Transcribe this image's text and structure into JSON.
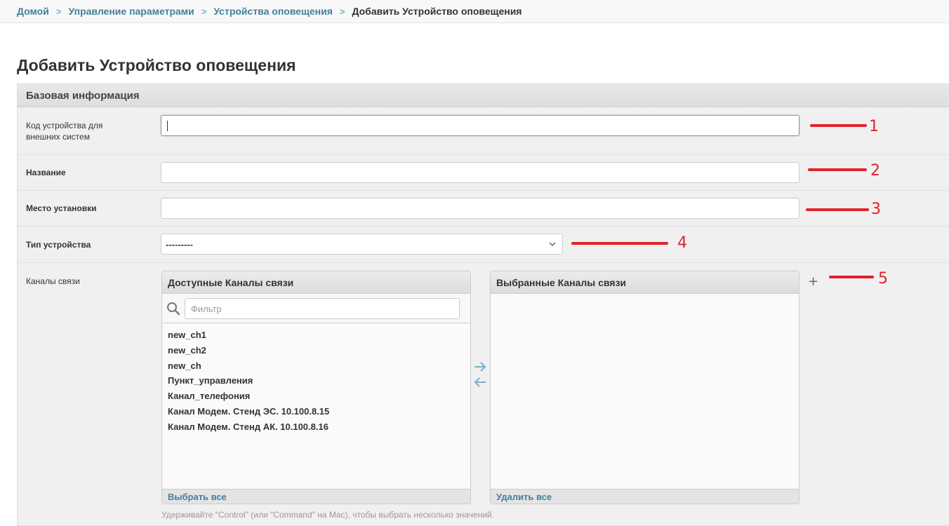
{
  "breadcrumbs": {
    "home": "Домой",
    "settings": "Управление параметрами",
    "devices": "Устройства оповещения",
    "current": "Добавить Устройство оповещения",
    "separator": ">"
  },
  "page": {
    "title": "Добавить Устройство оповещения"
  },
  "fieldset": {
    "title": "Базовая информация"
  },
  "fields": {
    "external_code": {
      "label": "Код устройства для внешних систем",
      "value": ""
    },
    "name": {
      "label": "Название",
      "value": ""
    },
    "location": {
      "label": "Место установки",
      "value": ""
    },
    "device_type": {
      "label": "Тип устройства",
      "selected": "---------"
    },
    "channels": {
      "label": "Каналы связи"
    }
  },
  "channels": {
    "available_title": "Доступные Каналы связи",
    "filter_placeholder": "Фильтр",
    "available": [
      "new_ch1",
      "new_ch2",
      "new_ch",
      "Пункт_управления",
      "Канал_телефония",
      "Канал Модем. Стенд ЭС. 10.100.8.15",
      "Канал Модем. Стенд АК. 10.100.8.16"
    ],
    "choose_all": "Выбрать все",
    "chosen_title": "Выбранные Каналы связи",
    "chosen": [],
    "remove_all": "Удалить все",
    "help_text": "Удерживайте \"Control\" (или \"Command\" на Mac), чтобы выбрать несколько значений.",
    "add_symbol": "+"
  },
  "annotations": [
    "1",
    "2",
    "3",
    "4",
    "5"
  ],
  "colors": {
    "link": "#447e9b",
    "annotation": "#e0232b",
    "arrows": "#79aec8"
  }
}
